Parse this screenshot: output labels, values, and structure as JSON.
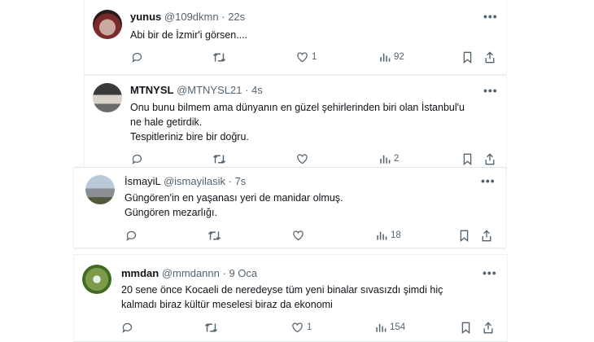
{
  "tweets": [
    {
      "name": "yunus",
      "handle": "@109dkmn",
      "sep": "·",
      "time": "22s",
      "lines": [
        "Abi bir de İzmir'i görsen...."
      ],
      "likes": "1",
      "views": "92"
    },
    {
      "name": "MTNYSL",
      "handle": "@MTNYSL21",
      "sep": "·",
      "time": "4s",
      "lines": [
        "Onu bunu bilmem ama dünyanın en güzel şehirlerinden biri olan İstanbul'u",
        "ne hale getirdik.",
        "Tespitleriniz bire bir doğru."
      ],
      "likes": "",
      "views": "2"
    },
    {
      "name": "İsmayiL",
      "handle": "@ismayilasik",
      "sep": "·",
      "time": "7s",
      "lines": [
        "Güngören'in en yaşanası yeri de manidar olmuş.",
        "Güngören mezarlığı."
      ],
      "likes": "",
      "views": "18"
    },
    {
      "name": "mmdan",
      "handle": "@mmdannn",
      "sep": "·",
      "time": "9 Oca",
      "lines": [
        "20 sene önce Kocaeli de neredeyse tüm yeni binalar sıvasızdı şimdi hiç",
        "kalmadı biraz kültür meselesi biraz da ekonomi"
      ],
      "likes": "1",
      "views": "154"
    }
  ],
  "more_label": "•••",
  "icons": [
    "reply-icon",
    "retweet-icon",
    "like-icon",
    "views-icon",
    "bookmark-icon",
    "share-icon"
  ],
  "colors": {
    "text": "#0f1419",
    "secondary": "#536471",
    "border": "#eff3f4"
  }
}
